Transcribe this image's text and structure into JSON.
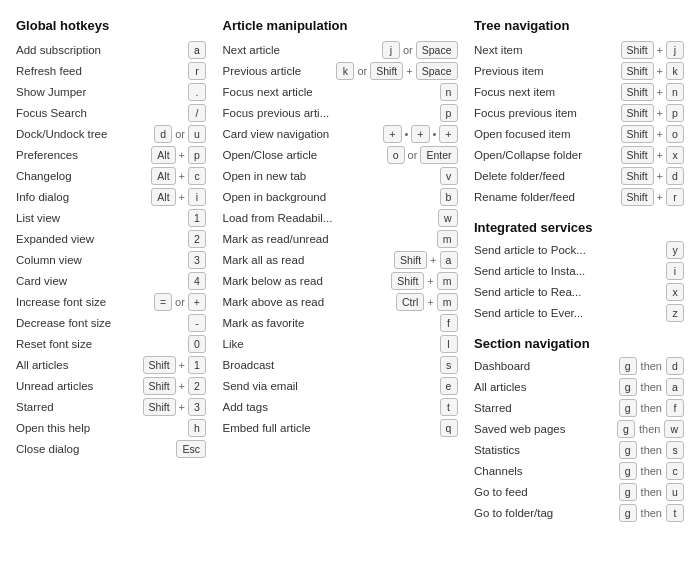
{
  "col1": {
    "title": "Global hotkeys",
    "rows": [
      {
        "label": "Add subscription",
        "keys": [
          [
            "a"
          ]
        ]
      },
      {
        "label": "Refresh feed",
        "keys": [
          [
            "r"
          ]
        ]
      },
      {
        "label": "Show Jumper",
        "keys": [
          [
            "."
          ]
        ]
      },
      {
        "label": "Focus Search",
        "keys": [
          [
            "/"
          ]
        ]
      },
      {
        "label": "Dock/Undock tree",
        "keys": [
          [
            "d"
          ],
          "or",
          [
            "u"
          ]
        ]
      },
      {
        "label": "Preferences",
        "keys": [
          [
            "Alt"
          ],
          "+",
          [
            "p"
          ]
        ]
      },
      {
        "label": "Changelog",
        "keys": [
          [
            "Alt"
          ],
          "+",
          [
            "c"
          ]
        ]
      },
      {
        "label": "Info dialog",
        "keys": [
          [
            "Alt"
          ],
          "+",
          [
            "i"
          ]
        ]
      },
      {
        "label": "List view",
        "keys": [
          [
            "1"
          ]
        ]
      },
      {
        "label": "Expanded view",
        "keys": [
          [
            "2"
          ]
        ]
      },
      {
        "label": "Column view",
        "keys": [
          [
            "3"
          ]
        ]
      },
      {
        "label": "Card view",
        "keys": [
          [
            "4"
          ]
        ]
      },
      {
        "label": "Increase font size",
        "keys": [
          [
            "="
          ],
          "or",
          [
            "+"
          ]
        ]
      },
      {
        "label": "Decrease font size",
        "keys": [
          [
            "-"
          ]
        ]
      },
      {
        "label": "Reset font size",
        "keys": [
          [
            "0"
          ]
        ]
      },
      {
        "label": "All articles",
        "keys": [
          [
            "Shift"
          ],
          "+",
          [
            "1"
          ]
        ]
      },
      {
        "label": "Unread articles",
        "keys": [
          [
            "Shift"
          ],
          "+",
          [
            "2"
          ]
        ]
      },
      {
        "label": "Starred",
        "keys": [
          [
            "Shift"
          ],
          "+",
          [
            "3"
          ]
        ]
      },
      {
        "label": "Open this help",
        "keys": [
          [
            "h"
          ]
        ]
      },
      {
        "label": "Close dialog",
        "keys": [
          [
            "Esc"
          ]
        ]
      }
    ]
  },
  "col2": {
    "title": "Article manipulation",
    "rows": [
      {
        "label": "Next article",
        "keys": [
          [
            "j"
          ],
          "or",
          [
            "Space"
          ]
        ]
      },
      {
        "label": "Previous article",
        "keys": [
          [
            "k"
          ],
          "or",
          [
            "Shift"
          ],
          "+",
          [
            "Space"
          ]
        ]
      },
      {
        "label": "Focus next article",
        "keys": [
          [
            "n"
          ]
        ]
      },
      {
        "label": "Focus previous arti...",
        "keys": [
          [
            "p"
          ]
        ]
      },
      {
        "label": "Card view navigation",
        "keys": [
          [
            "+"
          ],
          [
            "•"
          ],
          [
            "+"
          ],
          [
            "•"
          ],
          [
            "+"
          ]
        ]
      },
      {
        "label": "Open/Close article",
        "keys": [
          [
            "o"
          ],
          "or",
          [
            "Enter"
          ]
        ]
      },
      {
        "label": "Open in new tab",
        "keys": [
          [
            "v"
          ]
        ]
      },
      {
        "label": "Open in background",
        "keys": [
          [
            "b"
          ]
        ]
      },
      {
        "label": "Load from Readabil...",
        "keys": [
          [
            "w"
          ]
        ]
      },
      {
        "label": "Mark as read/unread",
        "keys": [
          [
            "m"
          ]
        ]
      },
      {
        "label": "Mark all as read",
        "keys": [
          [
            "Shift"
          ],
          "+",
          [
            "a"
          ]
        ]
      },
      {
        "label": "Mark below as read",
        "keys": [
          [
            "Shift"
          ],
          "+",
          [
            "m"
          ]
        ]
      },
      {
        "label": "Mark above as read",
        "keys": [
          [
            "Ctrl"
          ],
          "+",
          [
            "m"
          ]
        ]
      },
      {
        "label": "Mark as favorite",
        "keys": [
          [
            "f"
          ]
        ]
      },
      {
        "label": "Like",
        "keys": [
          [
            "l"
          ]
        ]
      },
      {
        "label": "Broadcast",
        "keys": [
          [
            "s"
          ]
        ]
      },
      {
        "label": "Send via email",
        "keys": [
          [
            "e"
          ]
        ]
      },
      {
        "label": "Add tags",
        "keys": [
          [
            "t"
          ]
        ]
      },
      {
        "label": "Embed full article",
        "keys": [
          [
            "q"
          ]
        ]
      }
    ]
  },
  "col3": {
    "tree_title": "Tree navigation",
    "tree_rows": [
      {
        "label": "Next item",
        "keys": [
          [
            "Shift"
          ],
          "+",
          [
            "j"
          ]
        ]
      },
      {
        "label": "Previous item",
        "keys": [
          [
            "Shift"
          ],
          "+",
          [
            "k"
          ]
        ]
      },
      {
        "label": "Focus next item",
        "keys": [
          [
            "Shift"
          ],
          "+",
          [
            "n"
          ]
        ]
      },
      {
        "label": "Focus previous item",
        "keys": [
          [
            "Shift"
          ],
          "+",
          [
            "p"
          ]
        ]
      },
      {
        "label": "Open focused item",
        "keys": [
          [
            "Shift"
          ],
          "+",
          [
            "o"
          ]
        ]
      },
      {
        "label": "Open/Collapse folder",
        "keys": [
          [
            "Shift"
          ],
          "+",
          [
            "x"
          ]
        ]
      },
      {
        "label": "Delete folder/feed",
        "keys": [
          [
            "Shift"
          ],
          "+",
          [
            "d"
          ]
        ]
      },
      {
        "label": "Rename folder/feed",
        "keys": [
          [
            "Shift"
          ],
          "+",
          [
            "r"
          ]
        ]
      }
    ],
    "integrated_title": "Integrated services",
    "integrated_rows": [
      {
        "label": "Send article to Pock...",
        "keys": [
          [
            "y"
          ]
        ]
      },
      {
        "label": "Send article to Insta...",
        "keys": [
          [
            "i"
          ]
        ]
      },
      {
        "label": "Send article to Rea...",
        "keys": [
          [
            "x"
          ]
        ]
      },
      {
        "label": "Send article to Ever...",
        "keys": [
          [
            "z"
          ]
        ]
      }
    ],
    "section_title": "Section navigation",
    "section_rows": [
      {
        "label": "Dashboard",
        "g": "g",
        "then": "then",
        "key": "d"
      },
      {
        "label": "All articles",
        "g": "g",
        "then": "then",
        "key": "a"
      },
      {
        "label": "Starred",
        "g": "g",
        "then": "then",
        "key": "f"
      },
      {
        "label": "Saved web pages",
        "g": "g",
        "then": "then",
        "key": "w"
      },
      {
        "label": "Statistics",
        "g": "g",
        "then": "then",
        "key": "s"
      },
      {
        "label": "Channels",
        "g": "g",
        "then": "then",
        "key": "c"
      },
      {
        "label": "Go to feed",
        "g": "g",
        "then": "then",
        "key": "u"
      },
      {
        "label": "Go to folder/tag",
        "g": "g",
        "then": "then",
        "key": "t"
      }
    ]
  }
}
